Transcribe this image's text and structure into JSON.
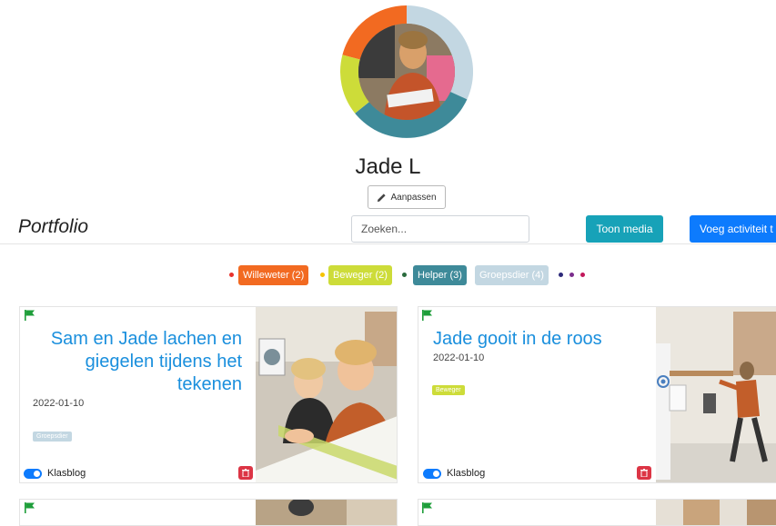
{
  "profile": {
    "name": "Jade L",
    "edit_label": "Aanpassen",
    "ring_colors": [
      "#f26a21",
      "#c3d7e2",
      "#3e8a99",
      "#cddc39"
    ]
  },
  "header": {
    "title": "Portfolio",
    "search_placeholder": "Zoeken...",
    "toon_media_label": "Toon media",
    "add_activity_label": "Voeg activiteit t"
  },
  "filters": {
    "tags": [
      {
        "label": "Willeweter (2)",
        "color": "#f26a21",
        "dot_color": "#e8322c"
      },
      {
        "label": "Beweger (2)",
        "color": "#cddc39",
        "dot_color": "#f5c400"
      },
      {
        "label": "Helper (3)",
        "color": "#3e8a99",
        "dot_color": "#2a6b3d"
      },
      {
        "label": "Groepsdier (4)",
        "color": "#c3d7e2",
        "dot_color": null
      }
    ],
    "trailing_dots": [
      "#2d2a7a",
      "#7b2d8c",
      "#c2185b"
    ]
  },
  "cards": [
    {
      "title": "Sam en Jade lachen en giegelen tijdens het tekenen",
      "date": "2022-01-10",
      "badge": "Groepsdier",
      "badge_color": "#c3d7e2",
      "toggle_label": "Klasblog",
      "toggle_on": true
    },
    {
      "title": "Jade gooit in de roos",
      "date": "2022-01-10",
      "badge": "Beweger",
      "badge_color": "#cddc39",
      "toggle_label": "Klasblog",
      "toggle_on": true
    }
  ],
  "colors": {
    "flag": "#1e9e3a",
    "title_blue": "#1a8fdd",
    "danger": "#dc3545",
    "primary": "#0d7bfd",
    "info": "#17a2b8"
  }
}
